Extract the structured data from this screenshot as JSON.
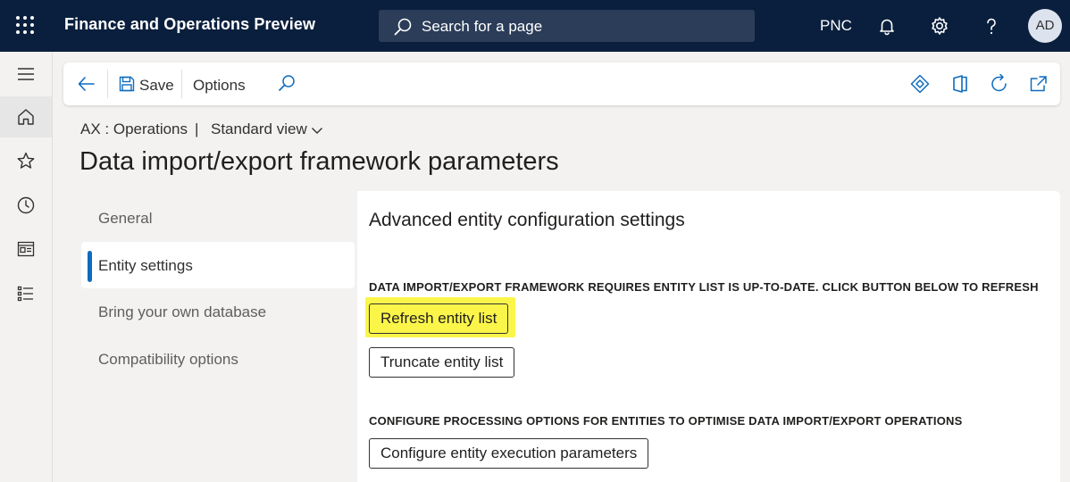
{
  "topbar": {
    "app_title": "Finance and Operations Preview",
    "search_placeholder": "Search for a page",
    "company": "PNC",
    "avatar_initials": "AD",
    "icons": [
      "waffle-icon",
      "search-icon",
      "bell-icon",
      "gear-icon",
      "help-icon"
    ]
  },
  "rail": {
    "items": [
      "hamburger-icon",
      "home-icon",
      "star-icon",
      "clock-icon",
      "workspace-icon",
      "list-icon"
    ]
  },
  "actionpane": {
    "save_label": "Save",
    "options_label": "Options",
    "right_icons": [
      "diamond-icon",
      "office-icon",
      "refresh-icon",
      "popout-icon"
    ]
  },
  "breadcrumb": {
    "path": "AX : Operations",
    "divider": "|",
    "view": "Standard view"
  },
  "page_title": "Data import/export framework parameters",
  "tabs": [
    {
      "label": "General",
      "active": false
    },
    {
      "label": "Entity settings",
      "active": true
    },
    {
      "label": "Bring your own database",
      "active": false
    },
    {
      "label": "Compatibility options",
      "active": false
    }
  ],
  "panel": {
    "title": "Advanced entity configuration settings",
    "section1_label": "DATA IMPORT/EXPORT FRAMEWORK REQUIRES ENTITY LIST IS UP-TO-DATE. CLICK BUTTON BELOW TO REFRESH",
    "refresh_button": "Refresh entity list",
    "truncate_button": "Truncate entity list",
    "section2_label": "CONFIGURE PROCESSING OPTIONS FOR ENTITIES TO OPTIMISE DATA IMPORT/EXPORT OPERATIONS",
    "configure_button": "Configure entity execution parameters"
  },
  "colors": {
    "topbar_bg": "#0a1f3d",
    "accent": "#0f6cbd",
    "highlight": "#fbf54a"
  }
}
